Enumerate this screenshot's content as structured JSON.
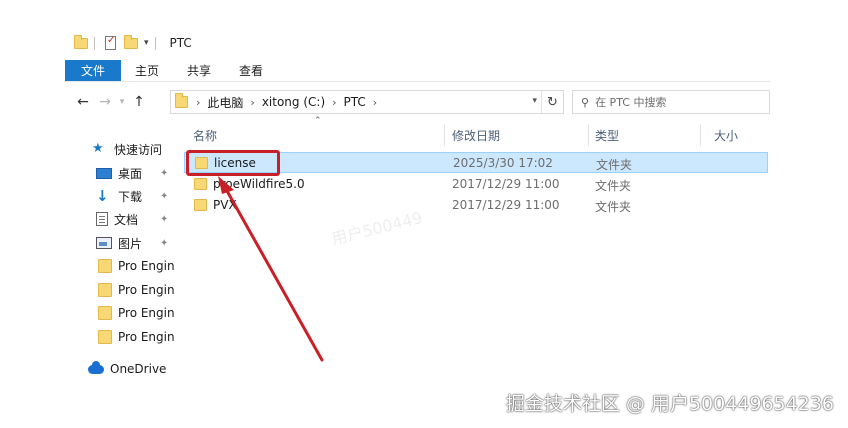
{
  "window": {
    "title": "PTC"
  },
  "ribbon": {
    "tabs": [
      "文件",
      "主页",
      "共享",
      "查看"
    ]
  },
  "address": {
    "crumbs": [
      "此电脑",
      "xitong (C:)",
      "PTC"
    ]
  },
  "search": {
    "placeholder": "在 PTC 中搜索"
  },
  "sidebar": {
    "items": [
      {
        "label": "快速访问",
        "icon": "star-icon"
      },
      {
        "label": "桌面",
        "icon": "desktop-icon",
        "pinned": true
      },
      {
        "label": "下载",
        "icon": "download-icon",
        "pinned": true
      },
      {
        "label": "文档",
        "icon": "document-icon",
        "pinned": true
      },
      {
        "label": "图片",
        "icon": "pictures-icon",
        "pinned": true
      },
      {
        "label": "Pro Engin",
        "icon": "folder-icon"
      },
      {
        "label": "Pro Engin",
        "icon": "folder-icon"
      },
      {
        "label": "Pro Engin",
        "icon": "folder-icon"
      },
      {
        "label": "Pro Engin",
        "icon": "folder-icon"
      },
      {
        "label": "OneDrive",
        "icon": "cloud-icon"
      }
    ]
  },
  "columns": {
    "name": "名称",
    "modified": "修改日期",
    "type": "类型",
    "size": "大小"
  },
  "files": [
    {
      "name": "license",
      "modified": "2025/3/30 17:02",
      "type": "文件夹",
      "selected": true
    },
    {
      "name": "proeWildfire5.0",
      "modified": "2017/12/29 11:00",
      "type": "文件夹"
    },
    {
      "name": "PVX",
      "modified": "2017/12/29 11:00",
      "type": "文件夹"
    }
  ],
  "annotation_color": "#c91f26",
  "accent_color": "#1979ca",
  "watermark": {
    "faint": "用户500449",
    "footer": "掘金技术社区 @ 用户500449654236"
  }
}
